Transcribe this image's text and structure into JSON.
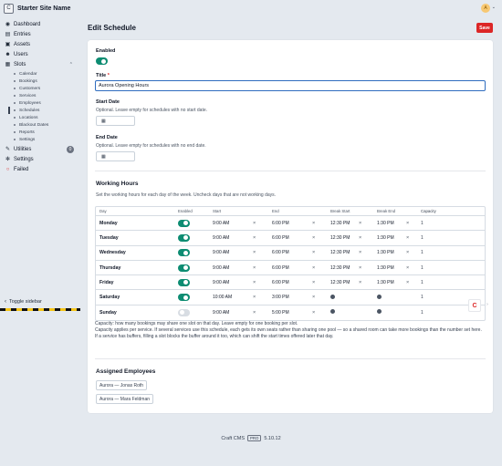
{
  "app": {
    "site_logo": "C",
    "site_name": "Starter Site Name",
    "user_initial": "A"
  },
  "nav": {
    "dashboard": "Dashboard",
    "entries": "Entries",
    "assets": "Assets",
    "users": "Users",
    "slots": "Slots",
    "slots_sub": [
      "Calendar",
      "Bookings",
      "Customers",
      "Services",
      "Employees",
      "Schedules",
      "Locations",
      "Blackout Dates",
      "Reports",
      "Settings"
    ],
    "utilities": "Utilities",
    "utilities_badge": "0",
    "settings": "Settings",
    "failed": "Failed",
    "toggle_sidebar": "Toggle sidebar"
  },
  "page": {
    "title": "Edit Schedule",
    "save_label": "Save"
  },
  "form": {
    "enabled_label": "Enabled",
    "title_label": "Title",
    "title_required": "*",
    "title_value": "Aurora Opening Hours",
    "start_date_label": "Start Date",
    "start_date_hint": "Optional. Leave empty for schedules with no start date.",
    "end_date_label": "End Date",
    "end_date_hint": "Optional. Leave empty for schedules with no end date."
  },
  "working_hours": {
    "title": "Working Hours",
    "hint": "Set the working hours for each day of the week. Uncheck days that are not working days.",
    "columns": [
      "Day",
      "Enabled",
      "Start",
      "End",
      "Break Start",
      "Break End",
      "Capacity"
    ],
    "rows": [
      {
        "day": "Monday",
        "enabled": true,
        "start": "9:00 AM",
        "end": "6:00 PM",
        "break_start": "12:30 PM",
        "break_end": "1:30 PM",
        "capacity": "1"
      },
      {
        "day": "Tuesday",
        "enabled": true,
        "start": "9:00 AM",
        "end": "6:00 PM",
        "break_start": "12:30 PM",
        "break_end": "1:30 PM",
        "capacity": "1"
      },
      {
        "day": "Wednesday",
        "enabled": true,
        "start": "9:00 AM",
        "end": "6:00 PM",
        "break_start": "12:30 PM",
        "break_end": "1:30 PM",
        "capacity": "1"
      },
      {
        "day": "Thursday",
        "enabled": true,
        "start": "9:00 AM",
        "end": "6:00 PM",
        "break_start": "12:30 PM",
        "break_end": "1:30 PM",
        "capacity": "1"
      },
      {
        "day": "Friday",
        "enabled": true,
        "start": "9:00 AM",
        "end": "6:00 PM",
        "break_start": "12:30 PM",
        "break_end": "1:30 PM",
        "capacity": "1"
      },
      {
        "day": "Saturday",
        "enabled": true,
        "start": "10:00 AM",
        "end": "3:00 PM",
        "break_start": "",
        "break_end": "",
        "capacity": "1"
      },
      {
        "day": "Sunday",
        "enabled": false,
        "start": "9:00 AM",
        "end": "5:00 PM",
        "break_start": "",
        "break_end": "",
        "capacity": "1"
      }
    ],
    "notes": [
      "Capacity: how many bookings may share one slot on that day. Leave empty for one booking per slot.",
      "Capacity applies per service. If several services use this schedule, each gets its own seats rather than sharing one pool — so a shared room can take more bookings than the number set here.",
      "If a service has buffers, filling a slot blocks the buffer around it too, which can shift the start times offered later that day."
    ]
  },
  "employees": {
    "title": "Assigned Employees",
    "items": [
      "Aurora — Jonas Roth",
      "Aurora — Mara Feldman"
    ]
  },
  "footer": {
    "product": "Craft CMS",
    "edition": "PRO",
    "version": "5.10.12"
  },
  "colors": {
    "accent": "#0d8c72",
    "save": "#dc2626",
    "focus": "#2f6dbf"
  }
}
